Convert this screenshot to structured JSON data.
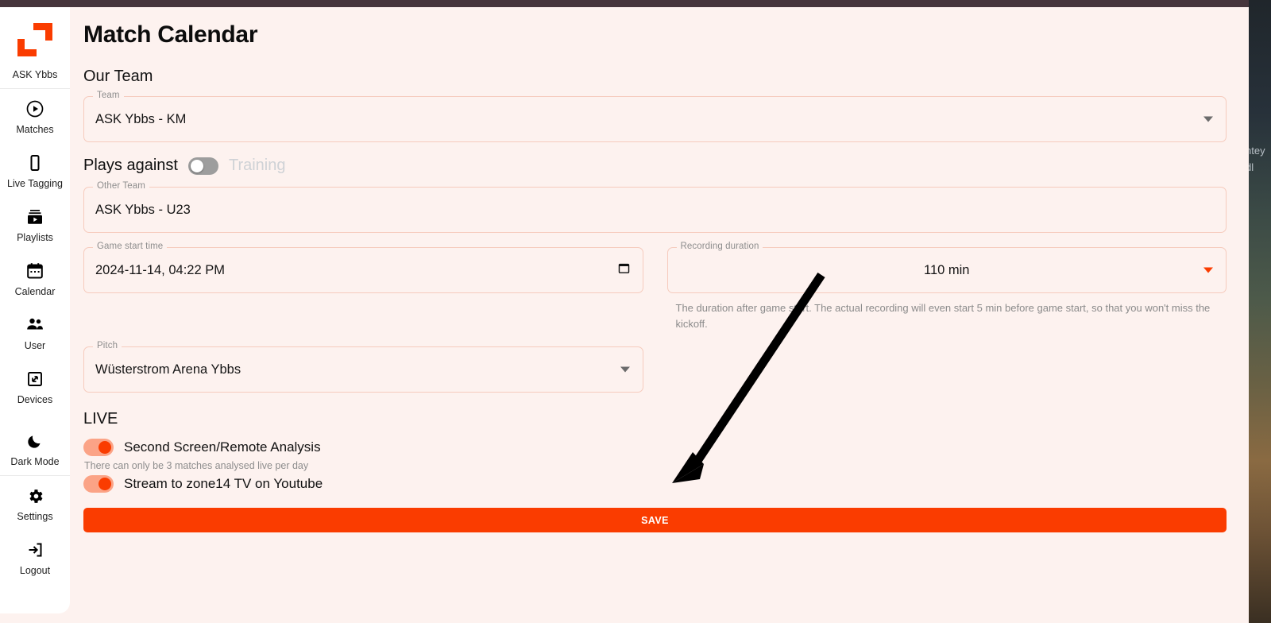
{
  "window": {
    "title_bar_color": "#46353c",
    "background": "#fdf2ef"
  },
  "theme": {
    "accent": "#fa3c00",
    "accent_soft": "#fba386",
    "field_border": "#f6cbbd",
    "muted_text": "#8d8d8d"
  },
  "sidebar": {
    "brand": "ASK Ybbs",
    "items": [
      {
        "label": "Matches",
        "icon": "play-circle-icon"
      },
      {
        "label": "Live Tagging",
        "icon": "mobile-phone-icon"
      },
      {
        "label": "Playlists",
        "icon": "video-library-icon"
      },
      {
        "label": "Calendar",
        "icon": "calendar-icon"
      },
      {
        "label": "User",
        "icon": "people-icon"
      },
      {
        "label": "Devices",
        "icon": "device-frame-icon"
      },
      {
        "label": "Dark Mode",
        "icon": "moon-icon"
      },
      {
        "label": "Settings",
        "icon": "gear-icon"
      },
      {
        "label": "Logout",
        "icon": "logout-arrow-icon"
      }
    ]
  },
  "page": {
    "title": "Match Calendar"
  },
  "our_team": {
    "section_title": "Our Team",
    "team_field_label": "Team",
    "team_value": "ASK Ybbs - KM"
  },
  "plays_against": {
    "label": "Plays against",
    "training_label": "Training",
    "training_enabled": false,
    "other_team_label": "Other Team",
    "other_team_value": "ASK Ybbs - U23"
  },
  "game_start": {
    "label": "Game start time",
    "value": "2024-11-14, 04:22 PM",
    "picker_icon": "calendar-picker-icon"
  },
  "recording_duration": {
    "label": "Recording duration",
    "value": "110 min",
    "helper": "The duration after game start. The actual recording will even start 5 min before game start, so that you won't miss the kickoff."
  },
  "pitch": {
    "label": "Pitch",
    "value": "Wüsterstrom Arena Ybbs"
  },
  "live": {
    "section_title": "LIVE",
    "second_screen_label": "Second Screen/Remote Analysis",
    "second_screen_enabled": true,
    "second_screen_note": "There can only be 3 matches analysed live per day",
    "stream_label": "Stream to zone14 TV on Youtube",
    "stream_enabled": true
  },
  "actions": {
    "save_label": "SAVE"
  },
  "desktop": {
    "edge_text": "ntey dl"
  }
}
